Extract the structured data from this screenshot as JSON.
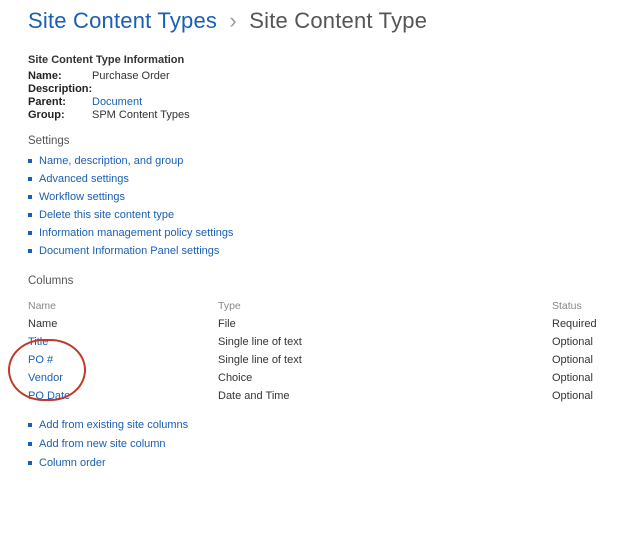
{
  "breadcrumb": {
    "parent": "Site Content Types",
    "current": "Site Content Type"
  },
  "info": {
    "heading": "Site Content Type Information",
    "labels": {
      "name": "Name:",
      "description": "Description:",
      "parent": "Parent:",
      "group": "Group:"
    },
    "values": {
      "name": "Purchase Order",
      "description": "",
      "parent": "Document",
      "group": "SPM Content Types"
    }
  },
  "settings": {
    "heading": "Settings",
    "links": [
      "Name, description, and group",
      "Advanced settings",
      "Workflow settings",
      "Delete this site content type",
      "Information management policy settings",
      "Document Information Panel settings"
    ]
  },
  "columns": {
    "heading": "Columns",
    "headers": {
      "name": "Name",
      "type": "Type",
      "status": "Status"
    },
    "rows": [
      {
        "name": "Name",
        "type": "File",
        "status": "Required",
        "link": false
      },
      {
        "name": "Title",
        "type": "Single line of text",
        "status": "Optional",
        "link": true
      },
      {
        "name": "PO #",
        "type": "Single line of text",
        "status": "Optional",
        "link": true
      },
      {
        "name": "Vendor",
        "type": "Choice",
        "status": "Optional",
        "link": true
      },
      {
        "name": "PO Date",
        "type": "Date and Time",
        "status": "Optional",
        "link": true
      }
    ],
    "actions": [
      "Add from existing site columns",
      "Add from new site column",
      "Column order"
    ]
  }
}
